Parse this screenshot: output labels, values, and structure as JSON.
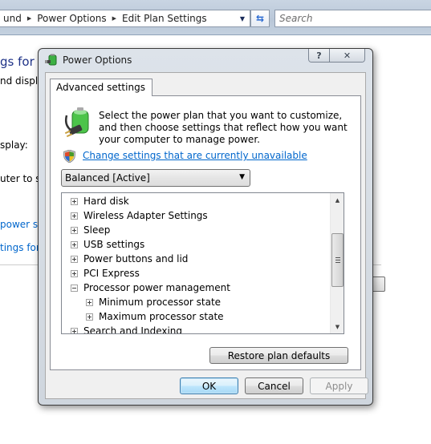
{
  "explorer": {
    "breadcrumbs": [
      "und",
      "Power Options",
      "Edit Plan Settings"
    ],
    "search_placeholder": "Search",
    "bg_title": "gs for th",
    "bg_lines": [
      "nd displa",
      "splay:",
      "uter to sle"
    ],
    "bg_links": [
      "power set",
      "tings for th"
    ]
  },
  "dialog": {
    "title": "Power Options",
    "help_glyph": "?",
    "close_glyph": "✕",
    "tab_label": "Advanced settings",
    "intro_text": "Select the power plan that you want to customize, and then choose settings that reflect how you want your computer to manage power.",
    "change_link": "Change settings that are currently unavailable",
    "plan_selected": "Balanced [Active]",
    "tree_items": [
      {
        "label": "Hard disk",
        "expanded": false,
        "level": 0
      },
      {
        "label": "Wireless Adapter Settings",
        "expanded": false,
        "level": 0
      },
      {
        "label": "Sleep",
        "expanded": false,
        "level": 0
      },
      {
        "label": "USB settings",
        "expanded": false,
        "level": 0
      },
      {
        "label": "Power buttons and lid",
        "expanded": false,
        "level": 0
      },
      {
        "label": "PCI Express",
        "expanded": false,
        "level": 0
      },
      {
        "label": "Processor power management",
        "expanded": true,
        "level": 0
      },
      {
        "label": "Minimum processor state",
        "expanded": false,
        "level": 1
      },
      {
        "label": "Maximum processor state",
        "expanded": false,
        "level": 1
      },
      {
        "label": "Search and Indexing",
        "expanded": false,
        "level": 0
      }
    ],
    "restore_label": "Restore plan defaults",
    "ok_label": "OK",
    "cancel_label": "Cancel",
    "apply_label": "Apply"
  }
}
